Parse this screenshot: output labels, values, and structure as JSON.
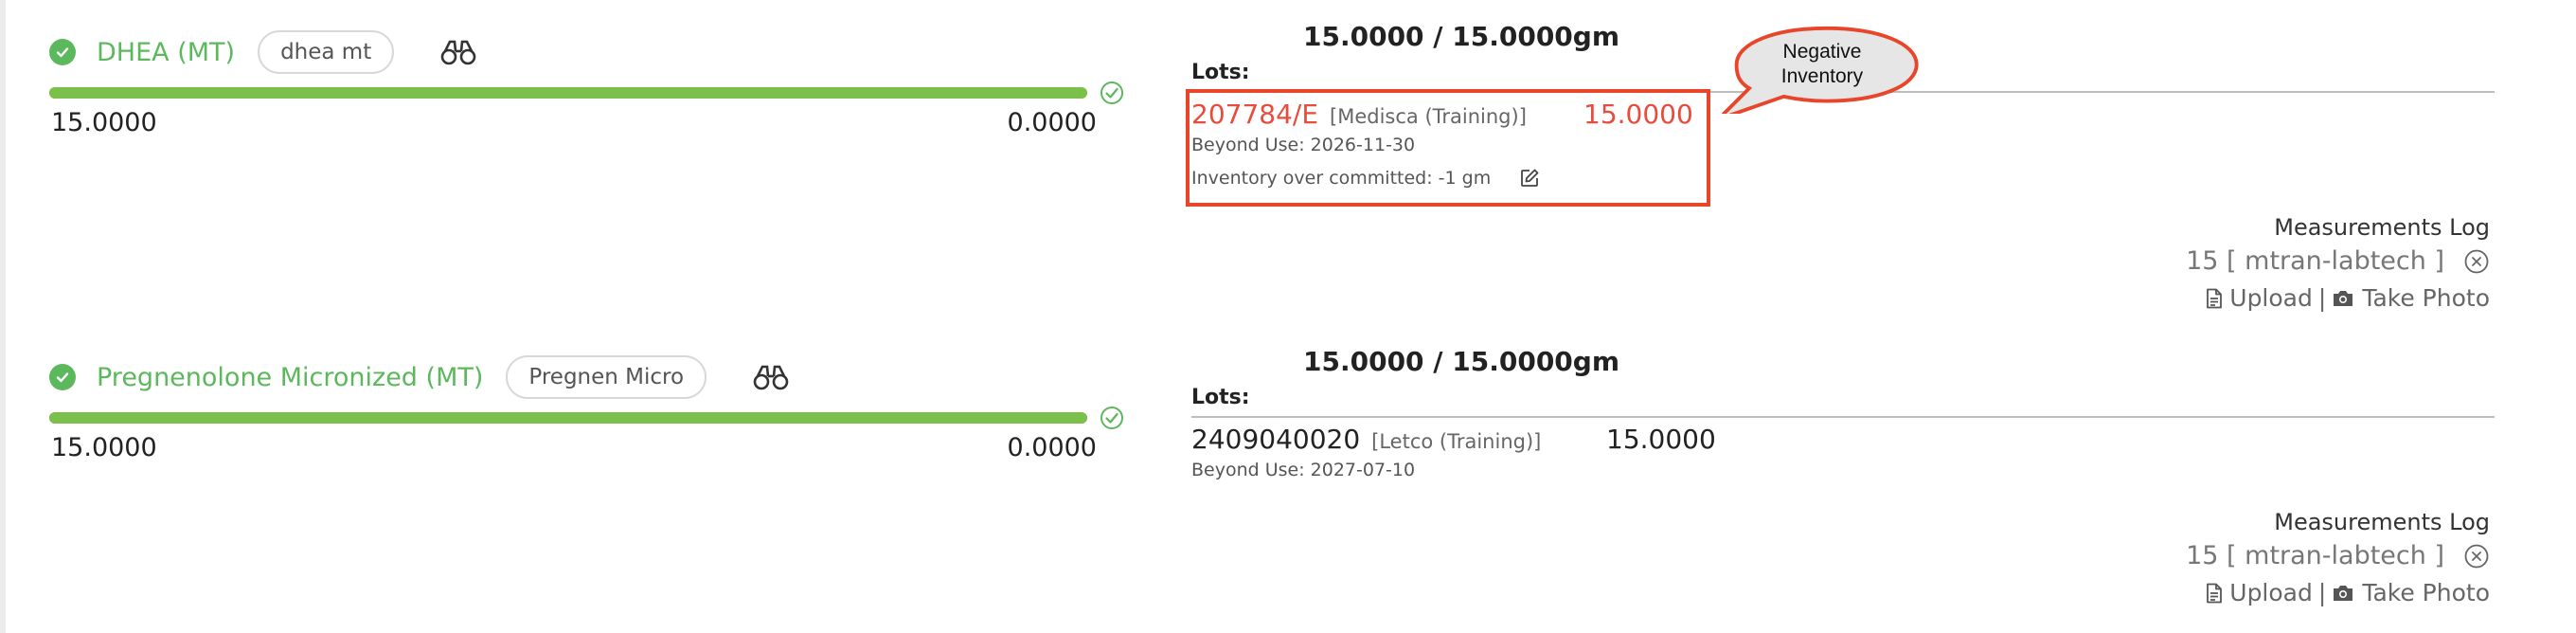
{
  "ingredients": [
    {
      "name": "DHEA (MT)",
      "short_name": "dhea mt",
      "progress": 1.0,
      "left_value": "15.0000",
      "right_value": "0.0000",
      "quantity": "15.0000 /  15.0000gm",
      "lots_label": "Lots:",
      "lot": {
        "number": "207784/E",
        "supplier": "[Medisca (Training)]",
        "quantity": "15.0000",
        "beyond_use": "Beyond Use: 2026-11-30",
        "over_committed": "Inventory over committed: -1 gm"
      },
      "callout": [
        "Negative",
        "Inventory"
      ],
      "measurements_label": "Measurements Log",
      "measurement_entry": "15 [ mtran-labtech ]",
      "upload_label": "Upload",
      "separator": "|",
      "take_photo_label": "Take Photo"
    },
    {
      "name": "Pregnenolone Micronized (MT)",
      "short_name": "Pregnen Micro",
      "progress": 1.0,
      "left_value": "15.0000",
      "right_value": "0.0000",
      "quantity": "15.0000 /  15.0000gm",
      "lots_label": "Lots:",
      "lot": {
        "number": "2409040020",
        "supplier": "[Letco (Training)]",
        "quantity": "15.0000",
        "beyond_use": "Beyond Use: 2027-07-10"
      },
      "measurements_label": "Measurements Log",
      "measurement_entry": "15 [ mtran-labtech ]",
      "upload_label": "Upload",
      "separator": "|",
      "take_photo_label": "Take Photo"
    }
  ],
  "colors": {
    "success_green": "#5cb85c",
    "bar_green": "#7bc04b",
    "negative_red": "#e74c3c",
    "highlight_border": "#e8452a"
  },
  "icons": {
    "status": "check-circle-icon",
    "lookup": "binoculars-icon",
    "bar_end": "check-outline-icon",
    "edit": "edit-icon",
    "remove": "x-circle-icon",
    "upload": "file-icon",
    "photo": "camera-icon"
  }
}
